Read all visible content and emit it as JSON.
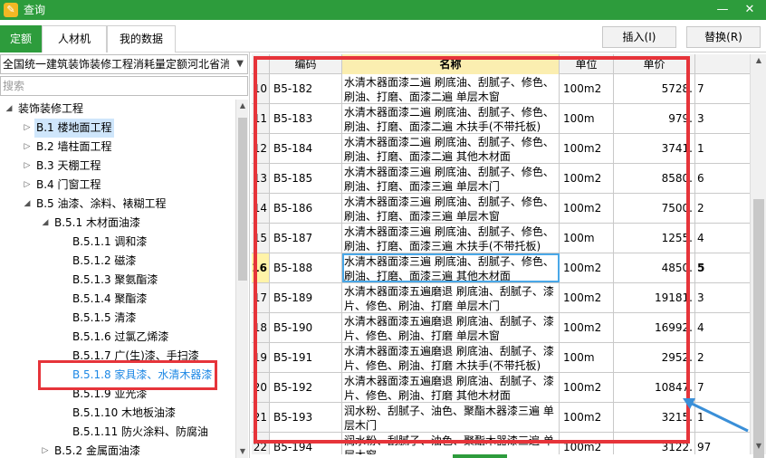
{
  "window": {
    "title": "查询",
    "minimize": "—",
    "close": "✕"
  },
  "tabs": [
    {
      "label": "定额",
      "active": true
    },
    {
      "label": "人材机",
      "active": false
    },
    {
      "label": "我的数据",
      "active": false
    }
  ],
  "actions": {
    "insert": "插入(I)",
    "replace": "替换(R)"
  },
  "library": {
    "selected": "全国统一建筑装饰装修工程消耗量定额河北省消耗"
  },
  "search": {
    "placeholder": "搜索"
  },
  "tree": [
    {
      "label": "装饰装修工程",
      "caret": "◢"
    },
    {
      "label": "B.1 楼地面工程",
      "caret": "▷",
      "selected": true
    },
    {
      "label": "B.2 墙柱面工程",
      "caret": "▷"
    },
    {
      "label": "B.3 天棚工程",
      "caret": "▷"
    },
    {
      "label": "B.4 门窗工程",
      "caret": "▷"
    },
    {
      "label": "B.5 油漆、涂料、裱糊工程",
      "caret": "◢"
    },
    {
      "label": "B.5.1 木材面油漆",
      "caret": "◢"
    },
    {
      "label": "B.5.1.1 调和漆",
      "caret": ""
    },
    {
      "label": "B.5.1.2 磁漆",
      "caret": ""
    },
    {
      "label": "B.5.1.3 聚氨酯漆",
      "caret": ""
    },
    {
      "label": "B.5.1.4 聚酯漆",
      "caret": ""
    },
    {
      "label": "B.5.1.5 清漆",
      "caret": ""
    },
    {
      "label": "B.5.1.6 过氯乙烯漆",
      "caret": ""
    },
    {
      "label": "B.5.1.7 广(生)漆、手扫漆",
      "caret": ""
    },
    {
      "label": "B.5.1.8 家具漆、水清木器漆",
      "caret": "",
      "highlight": true
    },
    {
      "label": "B.5.1.9 亚光漆",
      "caret": ""
    },
    {
      "label": "B.5.1.10 木地板油漆",
      "caret": ""
    },
    {
      "label": "B.5.1.11 防火涂料、防腐油",
      "caret": ""
    },
    {
      "label": "B.5.2 金属面油漆",
      "caret": "▷"
    }
  ],
  "grid": {
    "headers": {
      "code": "编码",
      "name": "名称",
      "unit": "单位",
      "price": "单价"
    },
    "rows": [
      {
        "num": "10",
        "code": "B5-182",
        "name": "水清木器面漆二遍 刷底油、刮腻子、修色、刷油、打磨、面漆二遍 单层木窗",
        "unit": "100m2",
        "price": "5728.",
        "tail": "7"
      },
      {
        "num": "11",
        "code": "B5-183",
        "name": "水清木器面漆二遍 刷底油、刮腻子、修色、刷油、打磨、面漆二遍 木扶手(不带托板)",
        "unit": "100m",
        "price": "979.",
        "tail": "3"
      },
      {
        "num": "12",
        "code": "B5-184",
        "name": "水清木器面漆二遍 刷底油、刮腻子、修色、刷油、打磨、面漆二遍 其他木材面",
        "unit": "100m2",
        "price": "3741.",
        "tail": "1"
      },
      {
        "num": "13",
        "code": "B5-185",
        "name": "水清木器面漆三遍 刷底油、刮腻子、修色、刷油、打磨、面漆三遍 单层木门",
        "unit": "100m2",
        "price": "8580.",
        "tail": "6"
      },
      {
        "num": "14",
        "code": "B5-186",
        "name": "水清木器面漆三遍 刷底油、刮腻子、修色、刷油、打磨、面漆三遍 单层木窗",
        "unit": "100m2",
        "price": "7500.",
        "tail": "2"
      },
      {
        "num": "15",
        "code": "B5-187",
        "name": "水清木器面漆三遍 刷底油、刮腻子、修色、刷油、打磨、面漆三遍 木扶手(不带托板)",
        "unit": "100m",
        "price": "1255.",
        "tail": "4"
      },
      {
        "num": "16",
        "code": "B5-188",
        "name": "水清木器面漆三遍 刷底油、刮腻子、修色、刷油、打磨、面漆三遍 其他木材面",
        "unit": "100m2",
        "price": "4850.",
        "tail": "5",
        "current": true
      },
      {
        "num": "17",
        "code": "B5-189",
        "name": "水清木器面漆五遍磨退 刷底油、刮腻子、漆片、修色、刷油、打磨 单层木门",
        "unit": "100m2",
        "price": "19181.",
        "tail": "3"
      },
      {
        "num": "18",
        "code": "B5-190",
        "name": "水清木器面漆五遍磨退 刷底油、刮腻子、漆片、修色、刷油、打磨 单层木窗",
        "unit": "100m2",
        "price": "16992.",
        "tail": "4"
      },
      {
        "num": "19",
        "code": "B5-191",
        "name": "水清木器面漆五遍磨退 刷底油、刮腻子、漆片、修色、刷油、打磨 木扶手(不带托板)",
        "unit": "100m",
        "price": "2952.",
        "tail": "2"
      },
      {
        "num": "20",
        "code": "B5-192",
        "name": "水清木器面漆五遍磨退 刷底油、刮腻子、漆片、修色、刷油、打磨 其他木材面",
        "unit": "100m2",
        "price": "10847.",
        "tail": "7"
      },
      {
        "num": "21",
        "code": "B5-193",
        "name": "润水粉、刮腻子、油色、聚酯木器漆三遍 单层木门",
        "unit": "100m2",
        "price": "3215.",
        "tail": "1"
      },
      {
        "num": "22",
        "code": "B5-194",
        "name": "润水粉、刮腻子、油色、聚酯木器漆三遍 单层木窗",
        "unit": "100m2",
        "price": "3122.",
        "tail": "97"
      }
    ]
  },
  "colors": {
    "brand": "#2d9c3c",
    "annotation": "#e6343a",
    "arrow": "#3a8fd8",
    "selection": "#cfe6fb",
    "link": "#1e88e5"
  }
}
